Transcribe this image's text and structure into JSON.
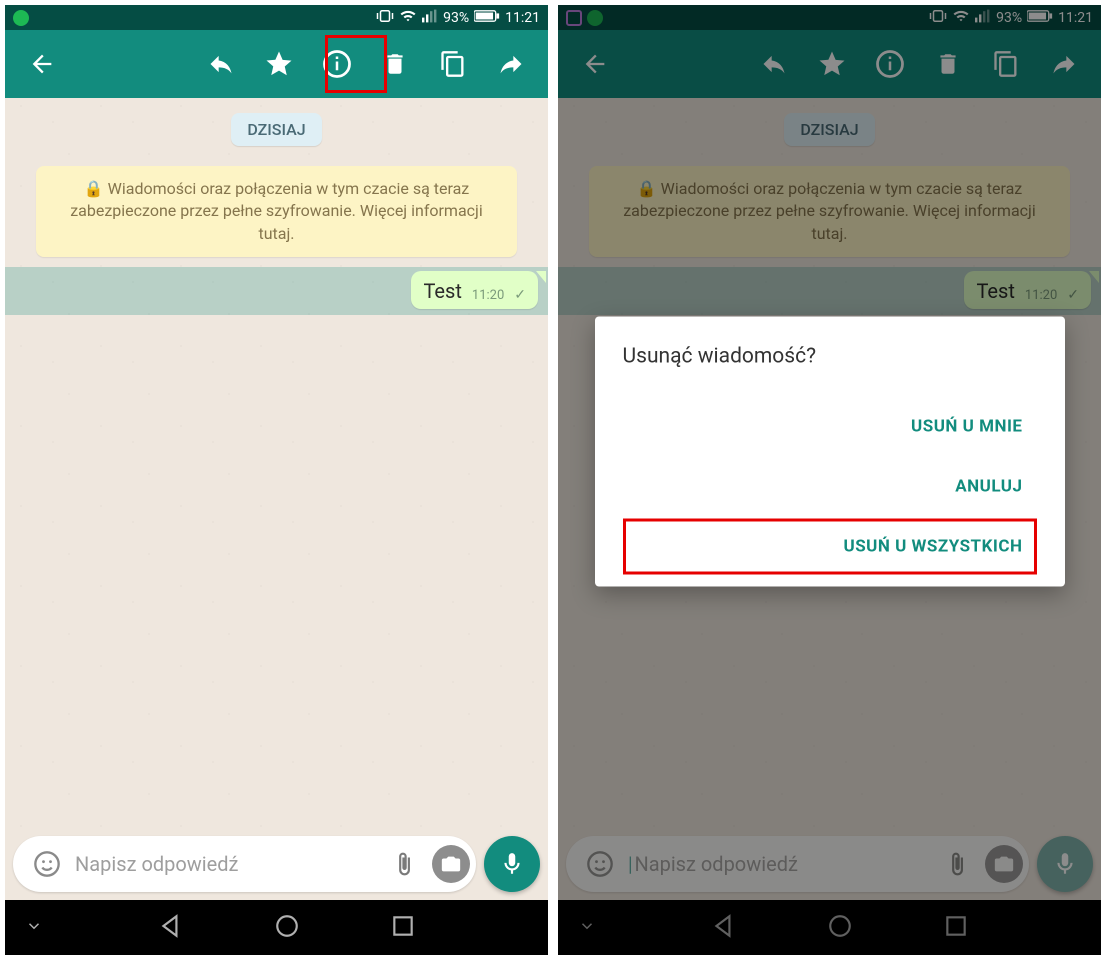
{
  "status": {
    "battery": "93%",
    "time": "11:21"
  },
  "date_label": "DZISIAJ",
  "encryption_notice": "🔒 Wiadomości oraz połączenia w tym czacie są teraz zabezpieczone przez pełne szyfrowanie. Więcej informacji tutaj.",
  "message": {
    "text": "Test",
    "time": "11:20"
  },
  "input": {
    "placeholder": "Napisz odpowiedź"
  },
  "dialog": {
    "title": "Usunąć wiadomość?",
    "delete_me": "USUŃ U MNIE",
    "cancel": "ANULUJ",
    "delete_all": "USUŃ U WSZYSTKICH"
  }
}
